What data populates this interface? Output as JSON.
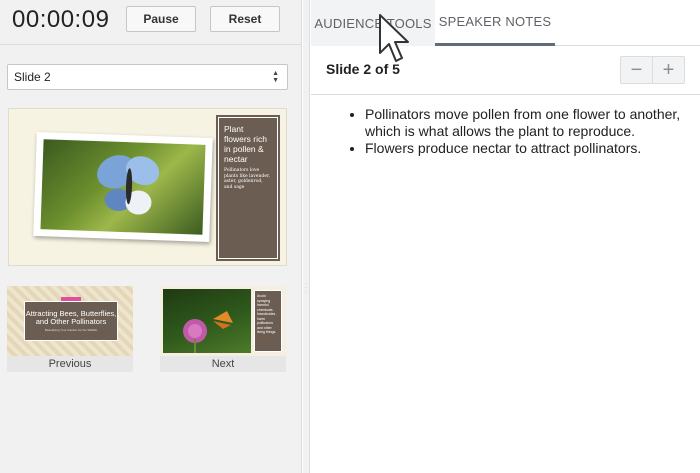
{
  "timer": {
    "elapsed": "00:00:09",
    "pause_label": "Pause",
    "reset_label": "Reset"
  },
  "slide_selector": {
    "selected": "Slide 2"
  },
  "current_slide": {
    "title": "Plant flowers rich in pollen & nectar",
    "body": "Pollinators love plants like lavender, aster, goldenrod, and sage"
  },
  "previous": {
    "caption": "Previous",
    "title": "Attracting Bees, Butterflies, and Other Pollinators",
    "subtitle": "Beautifying Your Garden for the Wildlife"
  },
  "next": {
    "caption": "Next",
    "text": "Avoid spraying harmful chemicals. Insecticides harm pollinators and other living things."
  },
  "tabs": [
    {
      "label": "AUDIENCE TOOLS"
    },
    {
      "label": "SPEAKER NOTES"
    }
  ],
  "notes": {
    "header": "Slide 2 of 5",
    "zoom_out_label": "−",
    "zoom_in_label": "+",
    "bullets": [
      "Pollinators move pollen from one flower to another, which is what allows the plant to reproduce.",
      "Flowers produce nectar to attract pollinators."
    ]
  },
  "colors": {
    "slide_box": "#6b5d52",
    "slide_bg": "#f7f3e3",
    "tab_underline": "#5f6d7a"
  }
}
